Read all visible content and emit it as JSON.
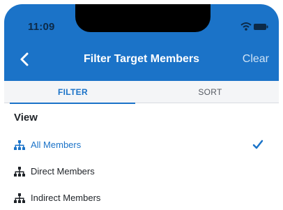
{
  "status_bar": {
    "time": "11:09",
    "icons": [
      "wifi-icon",
      "battery-icon"
    ]
  },
  "nav": {
    "title": "Filter Target Members",
    "clear_label": "Clear",
    "back_icon": "chevron-left-icon"
  },
  "tabs": [
    {
      "label": "FILTER",
      "active": true
    },
    {
      "label": "SORT",
      "active": false
    }
  ],
  "section": {
    "title": "View"
  },
  "options": [
    {
      "label": "All Members",
      "icon": "org-hierarchy-icon",
      "selected": true
    },
    {
      "label": "Direct Members",
      "icon": "org-hierarchy-icon",
      "selected": false
    },
    {
      "label": "Indirect Members",
      "icon": "org-hierarchy-icon",
      "selected": false
    }
  ],
  "colors": {
    "header_blue": "#1b73c8",
    "accent": "#1b73c8",
    "text": "#1f2328",
    "tab_bg": "#f4f5f7"
  }
}
